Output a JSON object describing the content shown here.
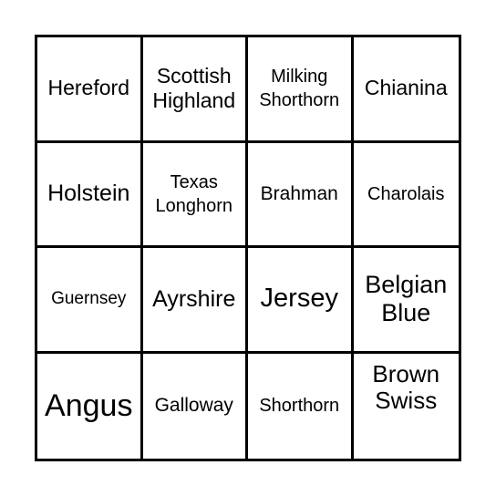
{
  "board": {
    "rows": [
      [
        {
          "label": "Hereford"
        },
        {
          "label": "Scottish Highland"
        },
        {
          "label": "Milking Shorthorn"
        },
        {
          "label": "Chianina"
        }
      ],
      [
        {
          "label": "Holstein"
        },
        {
          "label": "Texas Longhorn"
        },
        {
          "label": "Brahman"
        },
        {
          "label": "Charolais"
        }
      ],
      [
        {
          "label": "Guernsey"
        },
        {
          "label": "Ayrshire"
        },
        {
          "label": "Jersey"
        },
        {
          "label": "Belgian Blue"
        }
      ],
      [
        {
          "label": "Angus"
        },
        {
          "label": "Galloway"
        },
        {
          "label": "Shorthorn"
        },
        {
          "label": "Brown Swiss"
        }
      ]
    ]
  }
}
